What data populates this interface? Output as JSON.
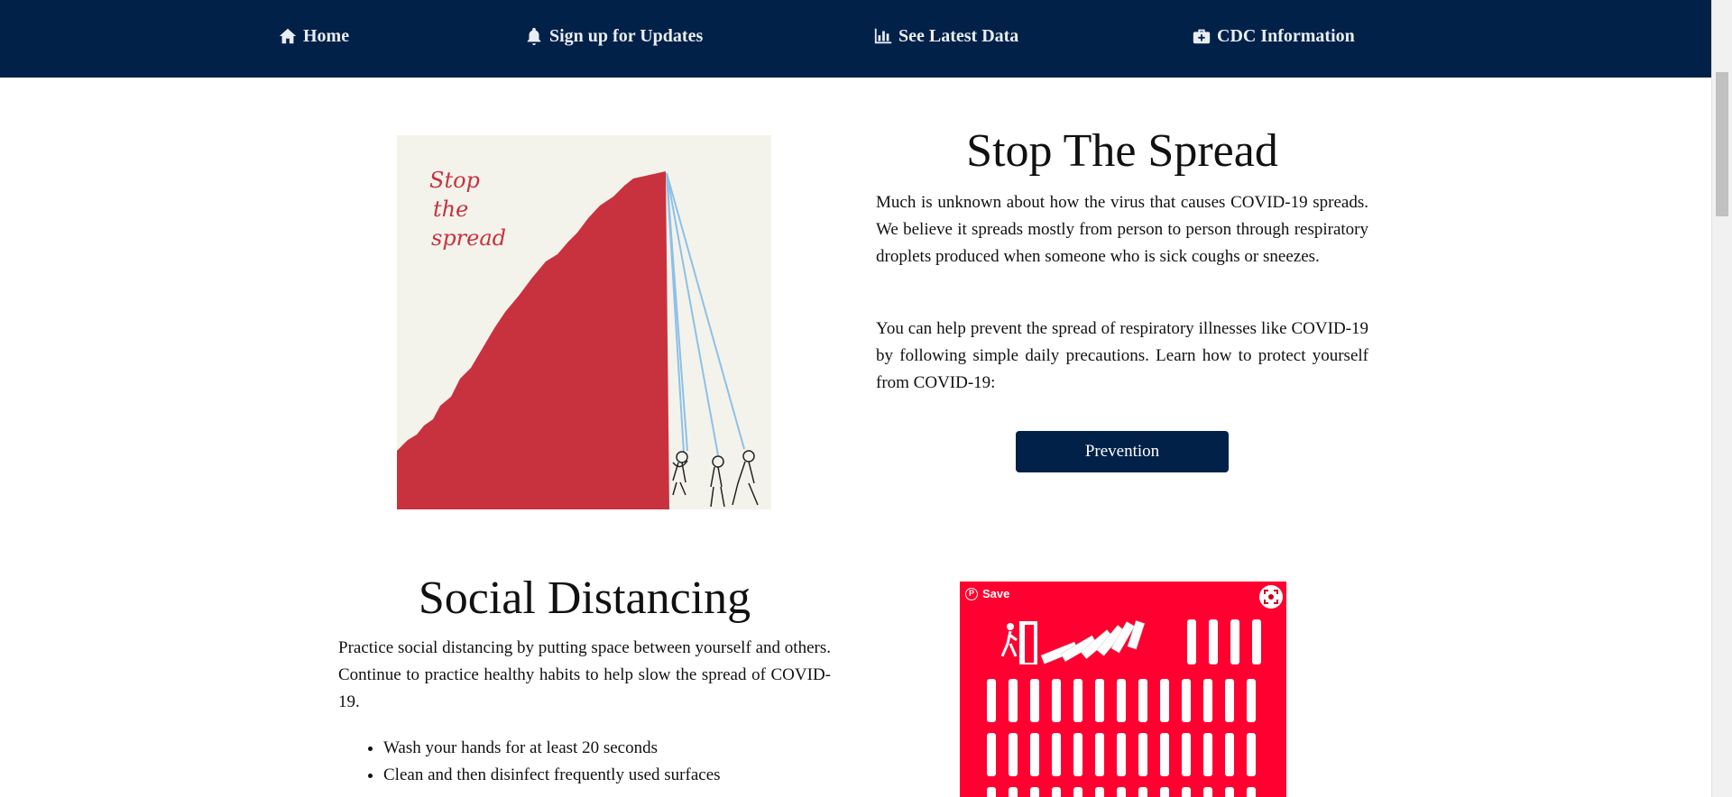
{
  "nav": {
    "items": [
      {
        "label": "Home",
        "icon": "home-icon"
      },
      {
        "label": "Sign up for Updates",
        "icon": "bell-icon"
      },
      {
        "label": "See Latest Data",
        "icon": "bar-chart-icon"
      },
      {
        "label": "CDC Information",
        "icon": "medkit-icon"
      }
    ]
  },
  "spread": {
    "image_text": [
      "Stop",
      "the",
      "spread"
    ],
    "title": "Stop The Spread",
    "p1": "Much is unknown about how the virus that causes COVID-19 spreads. We believe it spreads mostly from person to person through respiratory droplets produced when someone who is sick coughs or sneezes.",
    "p2": "You can help prevent the spread of respiratory illnesses like COVID-19 by following simple daily precautions. Learn how to protect yourself from COVID-19:",
    "button_label": "Prevention"
  },
  "distancing": {
    "title": "Social Distancing",
    "p1": "Practice social distancing by putting space between yourself and others. Continue to practice healthy habits to help slow the spread of COVID-19.",
    "habits": [
      "Wash your hands for at least 20 seconds",
      "Clean and then disinfect frequently used surfaces"
    ],
    "save_label": "Save"
  },
  "colors": {
    "navbar": "#012148",
    "button": "#012148",
    "poster_red": "#ff0030",
    "hero_red": "#c8323e"
  }
}
